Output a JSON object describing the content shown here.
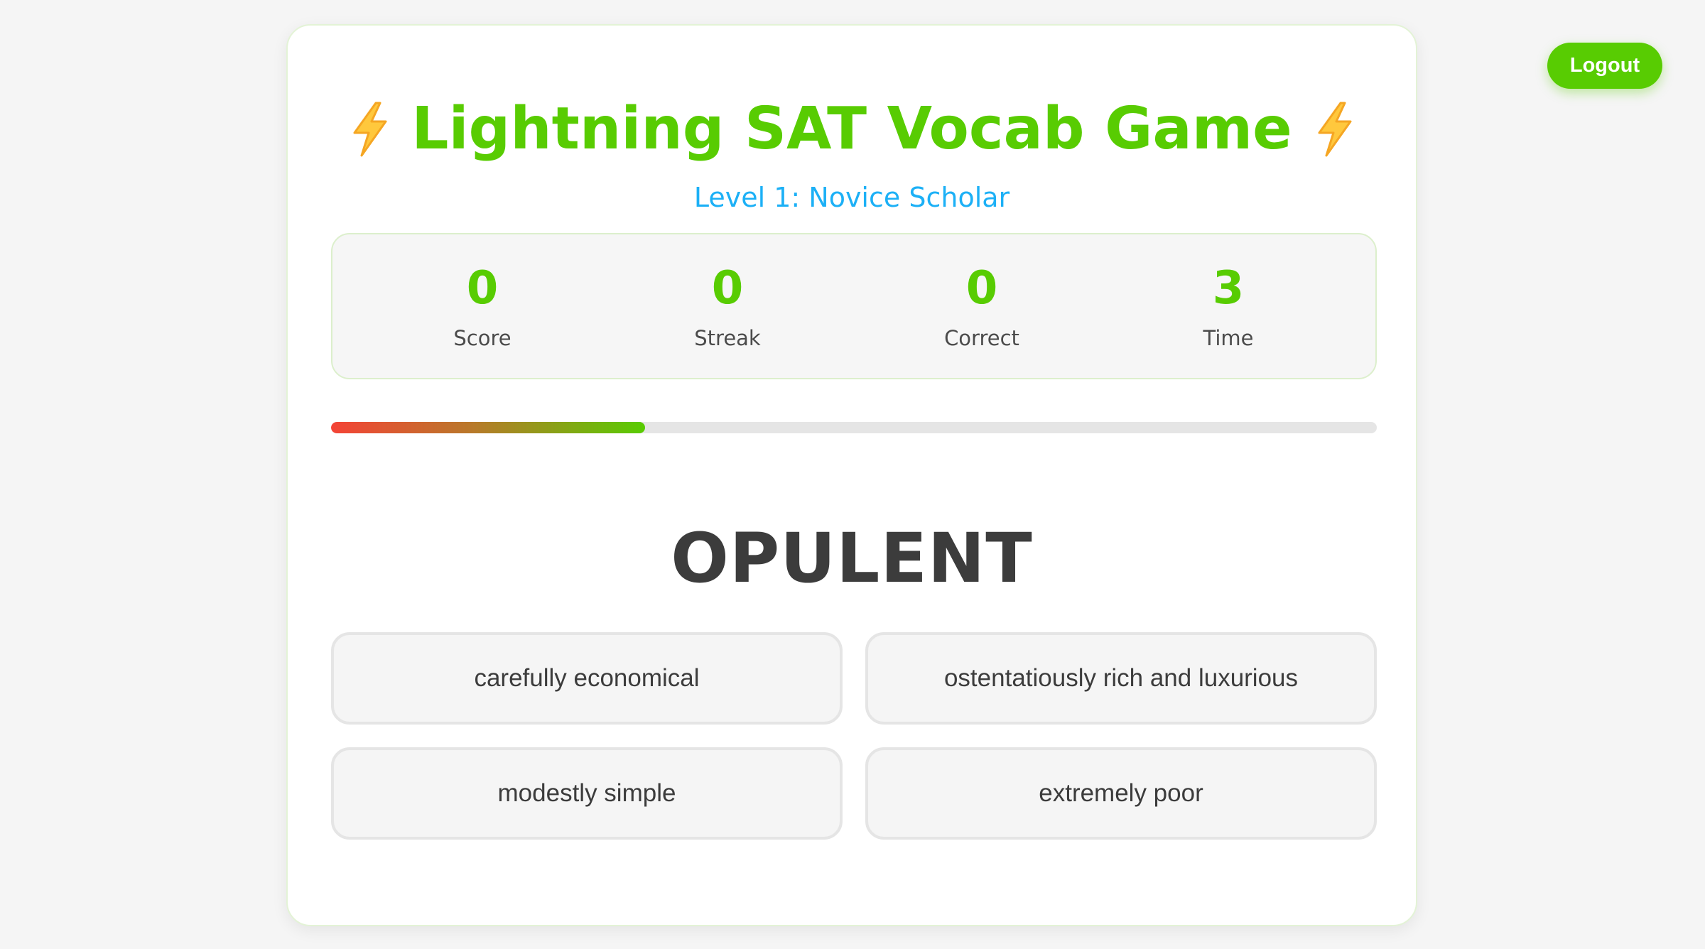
{
  "header": {
    "logout_label": "Logout"
  },
  "game": {
    "title": "Lightning SAT Vocab Game",
    "title_icon": "lightning-bolt",
    "level": "Level 1: Novice Scholar"
  },
  "stats": [
    {
      "value": "0",
      "label": "Score"
    },
    {
      "value": "0",
      "label": "Streak"
    },
    {
      "value": "0",
      "label": "Correct"
    },
    {
      "value": "3",
      "label": "Time"
    }
  ],
  "timer": {
    "remaining_fraction": 0.3
  },
  "question": {
    "word": "OPULENT",
    "options": [
      "carefully economical",
      "ostentatiously rich and luxurious",
      "modestly simple",
      "extremely poor"
    ]
  },
  "colors": {
    "accent": "#58cc02",
    "level_text": "#1cb0f6",
    "word_text": "#3c3c3c",
    "timer_start": "#f44336",
    "timer_end": "#58cc02",
    "bolt": "#f5a623"
  }
}
